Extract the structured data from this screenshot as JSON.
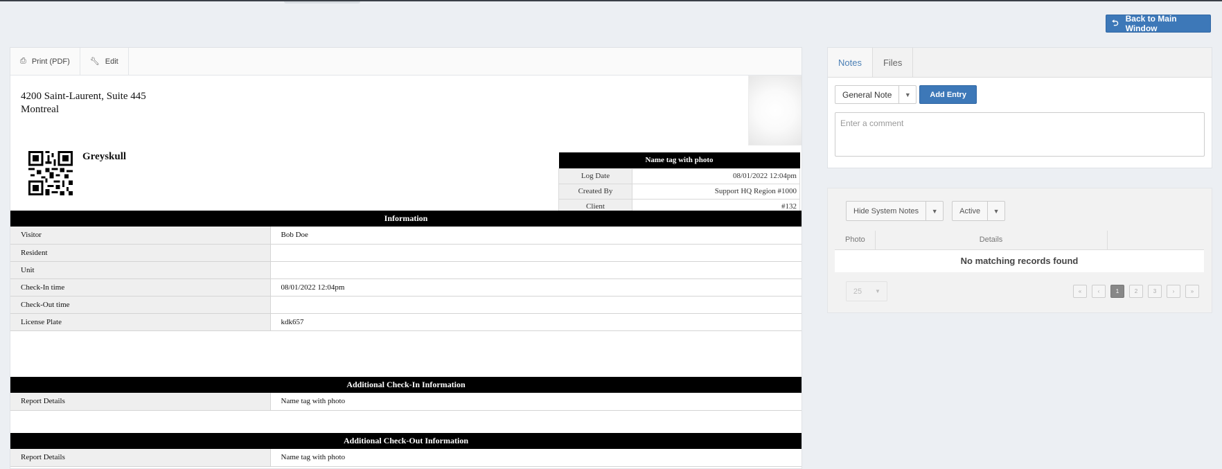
{
  "header": {
    "back_label": "Back to Main Window"
  },
  "toolbar": {
    "print_label": "Print (PDF)",
    "edit_label": "Edit"
  },
  "report": {
    "address_line1": "4200 Saint-Laurent, Suite 445",
    "address_line2": "Montreal",
    "site_name": "Greyskull",
    "name_tag": {
      "title": "Name tag with photo",
      "rows": [
        {
          "label": "Log Date",
          "value": "08/01/2022 12:04pm"
        },
        {
          "label": "Created By",
          "value": "Support HQ Region #1000"
        },
        {
          "label": "Client",
          "value": "#132"
        }
      ]
    },
    "information": {
      "title": "Information",
      "rows": [
        {
          "label": "Visitor",
          "value": "Bob Doe"
        },
        {
          "label": "Resident",
          "value": ""
        },
        {
          "label": "Unit",
          "value": ""
        },
        {
          "label": "Check-In time",
          "value": "08/01/2022 12:04pm"
        },
        {
          "label": "Check-Out time",
          "value": ""
        },
        {
          "label": "License Plate",
          "value": "kdk657"
        }
      ]
    },
    "check_in": {
      "title": "Additional Check-In Information",
      "rows": [
        {
          "label": "Report Details",
          "value": "Name tag with photo"
        }
      ]
    },
    "check_out": {
      "title": "Additional Check-Out Information",
      "rows": [
        {
          "label": "Report Details",
          "value": "Name tag with photo"
        }
      ]
    }
  },
  "notes": {
    "tabs": [
      {
        "label": "Notes",
        "active": true
      },
      {
        "label": "Files",
        "active": false
      }
    ],
    "note_type": "General Note",
    "add_entry_label": "Add Entry",
    "comment_placeholder": "Enter a comment",
    "filter_system": "Hide System Notes",
    "filter_status": "Active",
    "columns": [
      "Photo",
      "Details",
      ""
    ],
    "empty_message": "No matching records found",
    "page_size": "25",
    "pages": [
      "«",
      "‹",
      "1",
      "2",
      "3",
      "›",
      "»"
    ],
    "current_page": "1"
  },
  "colors": {
    "accent": "#3d78b8",
    "section_header": "#000000",
    "label_bg": "#efefef"
  },
  "icons": {
    "back": "back-arrow-icon",
    "print": "pdf-icon",
    "edit": "wrench-icon"
  }
}
